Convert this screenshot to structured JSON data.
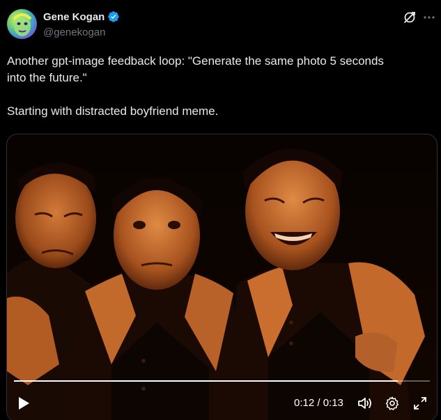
{
  "author": {
    "display_name": "Gene Kogan",
    "handle": "@genekogan",
    "verified": true,
    "avatar_icon": "avatar-image"
  },
  "tweet": {
    "text": "Another gpt-image feedback loop: \"Generate the same photo 5 seconds\ninto the future.\"\n\nStarting with distracted boyfriend meme."
  },
  "header_icons": [
    "grok-icon",
    "more-icon"
  ],
  "video": {
    "current_time": "0:12",
    "duration": "0:13",
    "time_display": "0:12 / 0:13",
    "progress_fraction": 0.923,
    "controls": [
      "play-icon",
      "volume-icon",
      "settings-icon",
      "fullscreen-icon"
    ]
  },
  "colors": {
    "background": "#000000",
    "text_primary": "#e7e9ea",
    "text_secondary": "#71767b",
    "verified_blue": "#1d9bf0",
    "photo_tint": "#b85a1c"
  }
}
